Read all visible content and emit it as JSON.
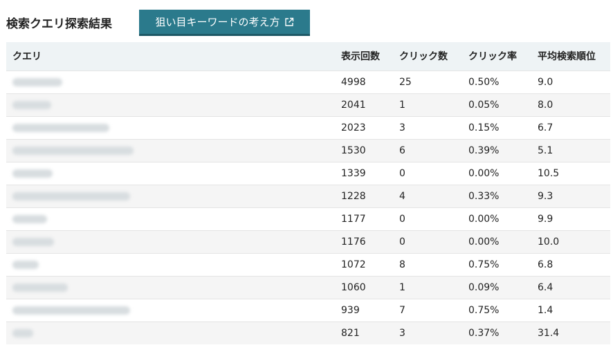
{
  "header": {
    "title": "検索クエリ探索結果",
    "guide_button_label": "狙い目キーワードの考え方",
    "guide_button_icon": "external-link-icon"
  },
  "table": {
    "columns": [
      "クエリ",
      "表示回数",
      "クリック数",
      "クリック率",
      "平均検索順位"
    ],
    "rows": [
      {
        "impressions": "4998",
        "clicks": "25",
        "ctr": "0.50%",
        "position": "9.0"
      },
      {
        "impressions": "2041",
        "clicks": "1",
        "ctr": "0.05%",
        "position": "8.0"
      },
      {
        "impressions": "2023",
        "clicks": "3",
        "ctr": "0.15%",
        "position": "6.7"
      },
      {
        "impressions": "1530",
        "clicks": "6",
        "ctr": "0.39%",
        "position": "5.1"
      },
      {
        "impressions": "1339",
        "clicks": "0",
        "ctr": "0.00%",
        "position": "10.5"
      },
      {
        "impressions": "1228",
        "clicks": "4",
        "ctr": "0.33%",
        "position": "9.3"
      },
      {
        "impressions": "1177",
        "clicks": "0",
        "ctr": "0.00%",
        "position": "9.9"
      },
      {
        "impressions": "1176",
        "clicks": "0",
        "ctr": "0.00%",
        "position": "10.0"
      },
      {
        "impressions": "1072",
        "clicks": "8",
        "ctr": "0.75%",
        "position": "6.8"
      },
      {
        "impressions": "1060",
        "clicks": "1",
        "ctr": "0.09%",
        "position": "6.4"
      },
      {
        "impressions": "939",
        "clicks": "7",
        "ctr": "0.75%",
        "position": "1.4"
      },
      {
        "impressions": "821",
        "clicks": "3",
        "ctr": "0.37%",
        "position": "31.4"
      }
    ]
  },
  "colors": {
    "button_bg": "#2b7a8c",
    "header_row_bg": "#eef3f5",
    "stripe_bg": "#f5f5f5"
  }
}
